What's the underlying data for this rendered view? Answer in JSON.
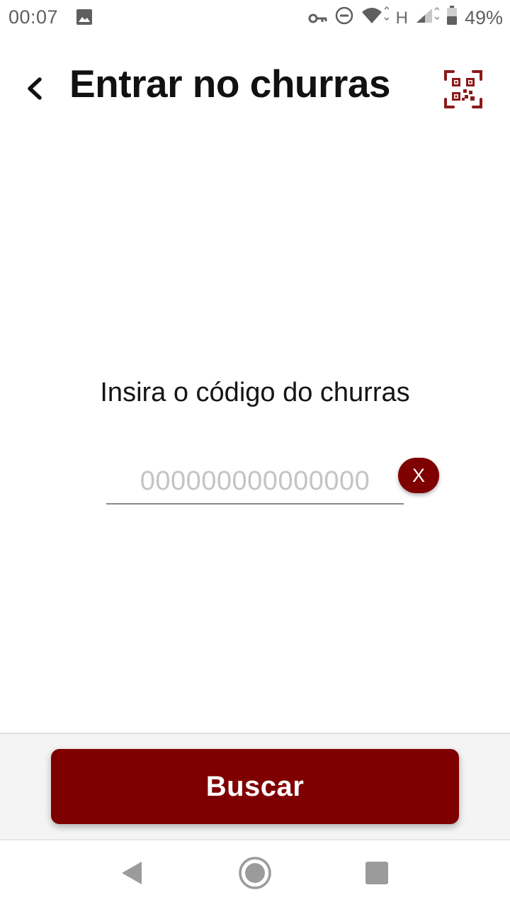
{
  "status_bar": {
    "time": "00:07",
    "network": "H",
    "battery": "49%",
    "icons": [
      "gallery-icon",
      "vpn-key-icon",
      "do-not-disturb-icon",
      "wifi-icon",
      "signal-icon",
      "battery-icon"
    ]
  },
  "header": {
    "title": "Entrar no churras",
    "back_icon": "chevron-left-icon",
    "qr_icon": "qr-code-icon"
  },
  "form": {
    "prompt": "Insira o código do churras",
    "code_value": "",
    "code_placeholder": "000000000000000",
    "clear_label": "X"
  },
  "actions": {
    "search_label": "Buscar"
  },
  "nav_bar": {
    "icons": [
      "nav-back-icon",
      "nav-home-icon",
      "nav-recents-icon"
    ]
  },
  "colors": {
    "accent": "#7f0000",
    "title_text": "#111111",
    "panel_bg": "#f4f4f4"
  }
}
